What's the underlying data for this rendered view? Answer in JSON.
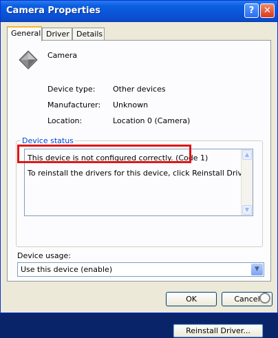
{
  "window": {
    "title": "Camera Properties",
    "help_label": "?",
    "close_label": "✕"
  },
  "tabs": [
    {
      "label": "General",
      "active": true
    },
    {
      "label": "Driver",
      "active": false
    },
    {
      "label": "Details",
      "active": false
    }
  ],
  "device": {
    "name": "Camera",
    "icon": "camera-device-icon",
    "fields": [
      {
        "label": "Device type:",
        "value": "Other devices"
      },
      {
        "label": "Manufacturer:",
        "value": "Unknown"
      },
      {
        "label": "Location:",
        "value": "Location 0 (Camera)"
      }
    ]
  },
  "status": {
    "group_label": "Device status",
    "line1": "This device is not configured correctly. (Code 1)",
    "line2": "To reinstall the drivers for this device, click Reinstall Driver.",
    "reinstall_button": "Reinstall Driver...",
    "highlight_color": "#e01515"
  },
  "usage": {
    "label": "Device usage:",
    "selected": "Use this device (enable)"
  },
  "buttons": {
    "ok": "OK",
    "cancel": "Cancel"
  },
  "colors": {
    "titlebar": "#0a52d6",
    "group_label": "#0046d5",
    "dialog_bg": "#ece9d8"
  }
}
